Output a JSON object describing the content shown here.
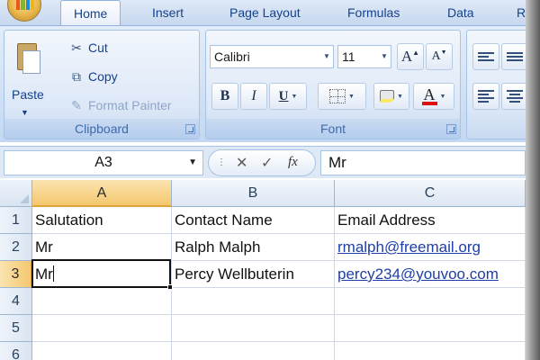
{
  "tabs": [
    {
      "label": "Home",
      "active": true
    },
    {
      "label": "Insert"
    },
    {
      "label": "Page Layout"
    },
    {
      "label": "Formulas"
    },
    {
      "label": "Data"
    },
    {
      "label": "R"
    }
  ],
  "ribbon": {
    "clipboard": {
      "paste_label": "Paste",
      "cut_label": "Cut",
      "copy_label": "Copy",
      "format_painter_label": "Format Painter",
      "group_label": "Clipboard"
    },
    "font": {
      "font_name": "Calibri",
      "font_size": "11",
      "grow_glyph": "A",
      "shrink_glyph": "A",
      "bold_glyph": "B",
      "italic_glyph": "I",
      "underline_glyph": "U",
      "color_glyph": "A",
      "group_label": "Font",
      "font_color": "#e01010",
      "fill_color": "#f7e96a"
    }
  },
  "formula_bar": {
    "name_box": "A3",
    "cancel_glyph": "✕",
    "enter_glyph": "✓",
    "fx_glyph": "fx",
    "content": "Mr"
  },
  "sheet": {
    "columns": [
      "A",
      "B",
      "C"
    ],
    "active_column": "A",
    "rows": [
      "1",
      "2",
      "3",
      "4",
      "5",
      "6"
    ],
    "active_row": "3",
    "selected_cell": "A3",
    "cells": {
      "A1": "Salutation",
      "B1": "Contact Name",
      "C1": "Email Address",
      "A2": "Mr",
      "B2": "Ralph Malph",
      "C2": "rmalph@freemail.org",
      "A3": "Mr",
      "B3": "Percy Wellbuterin",
      "C3": "percy234@youvoo.com"
    }
  }
}
